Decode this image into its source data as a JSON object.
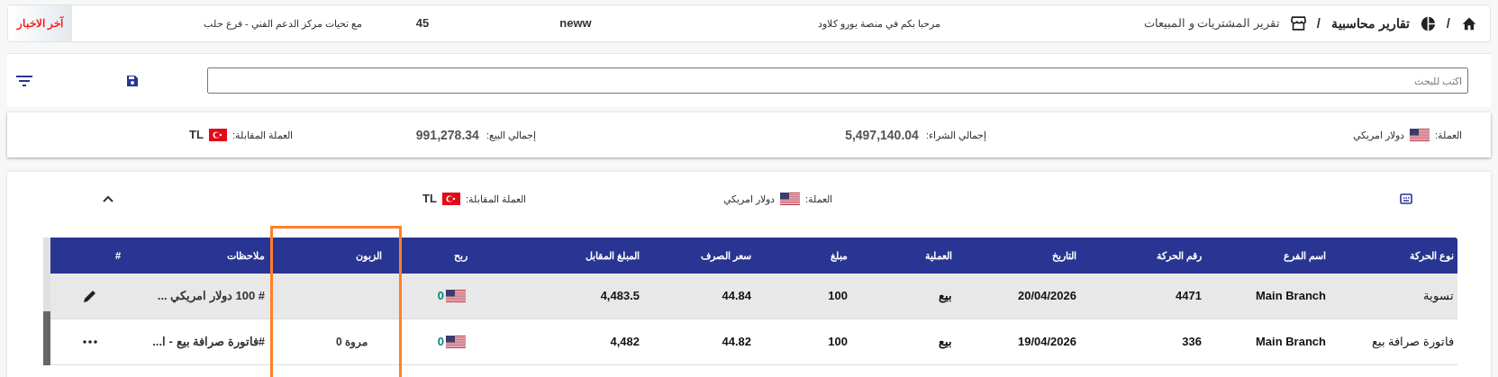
{
  "breadcrumb": {
    "root_separator": "/",
    "section": "تقارير محاسبية",
    "separator": "/",
    "page": "تقرير المشتريات و المبيعات"
  },
  "ticker": {
    "messages": [
      "مرحبا بكم في منصة يورو كلاود",
      "neww",
      "45",
      "مع تحيات مركز الدعم الفني - فرع حلب"
    ],
    "label": "آخر الاخبار"
  },
  "search": {
    "placeholder": "اكتب للبحث"
  },
  "totals": {
    "currency_label": "العملة:",
    "currency": "دولار امريكي",
    "purchase_label": "إجمالي الشراء:",
    "purchase": "5,497,140.04",
    "sale_label": "إجمالي البيع:",
    "sale": "991,278.34",
    "counter_label": "العملة المقابلة:",
    "counter": "TL"
  },
  "group": {
    "expanded": true,
    "currency_label": "العملة:",
    "currency": "دولار امريكي",
    "counter_label": "العملة المقابلة:",
    "counter": "TL"
  },
  "table": {
    "columns": [
      "نوع الحركة",
      "اسم الفرع",
      "رقم الحركة",
      "التاريخ",
      "العملية",
      "مبلغ",
      "سعر الصرف",
      "المبلغ المقابل",
      "ربح",
      "الزبون",
      "ملاحظات",
      "#"
    ],
    "rows": [
      {
        "selected": true,
        "cells": [
          "تسوية",
          "Main Branch",
          "4471",
          "20/04/2026",
          "بيع",
          "100",
          "44.84",
          "4,483.5"
        ],
        "profit": "0",
        "customer": "",
        "notes": "# 100 دولار امريكي ...",
        "kind": "edit"
      },
      {
        "selected": false,
        "cells": [
          "فاتورة صرافة بيع",
          "Main Branch",
          "336",
          "19/04/2026",
          "بيع",
          "100",
          "44.82",
          "4,482"
        ],
        "profit": "0",
        "customer": "مروة 0",
        "notes": "#فاتورة صرافة بيع - ا...",
        "kind": "more"
      }
    ]
  }
}
